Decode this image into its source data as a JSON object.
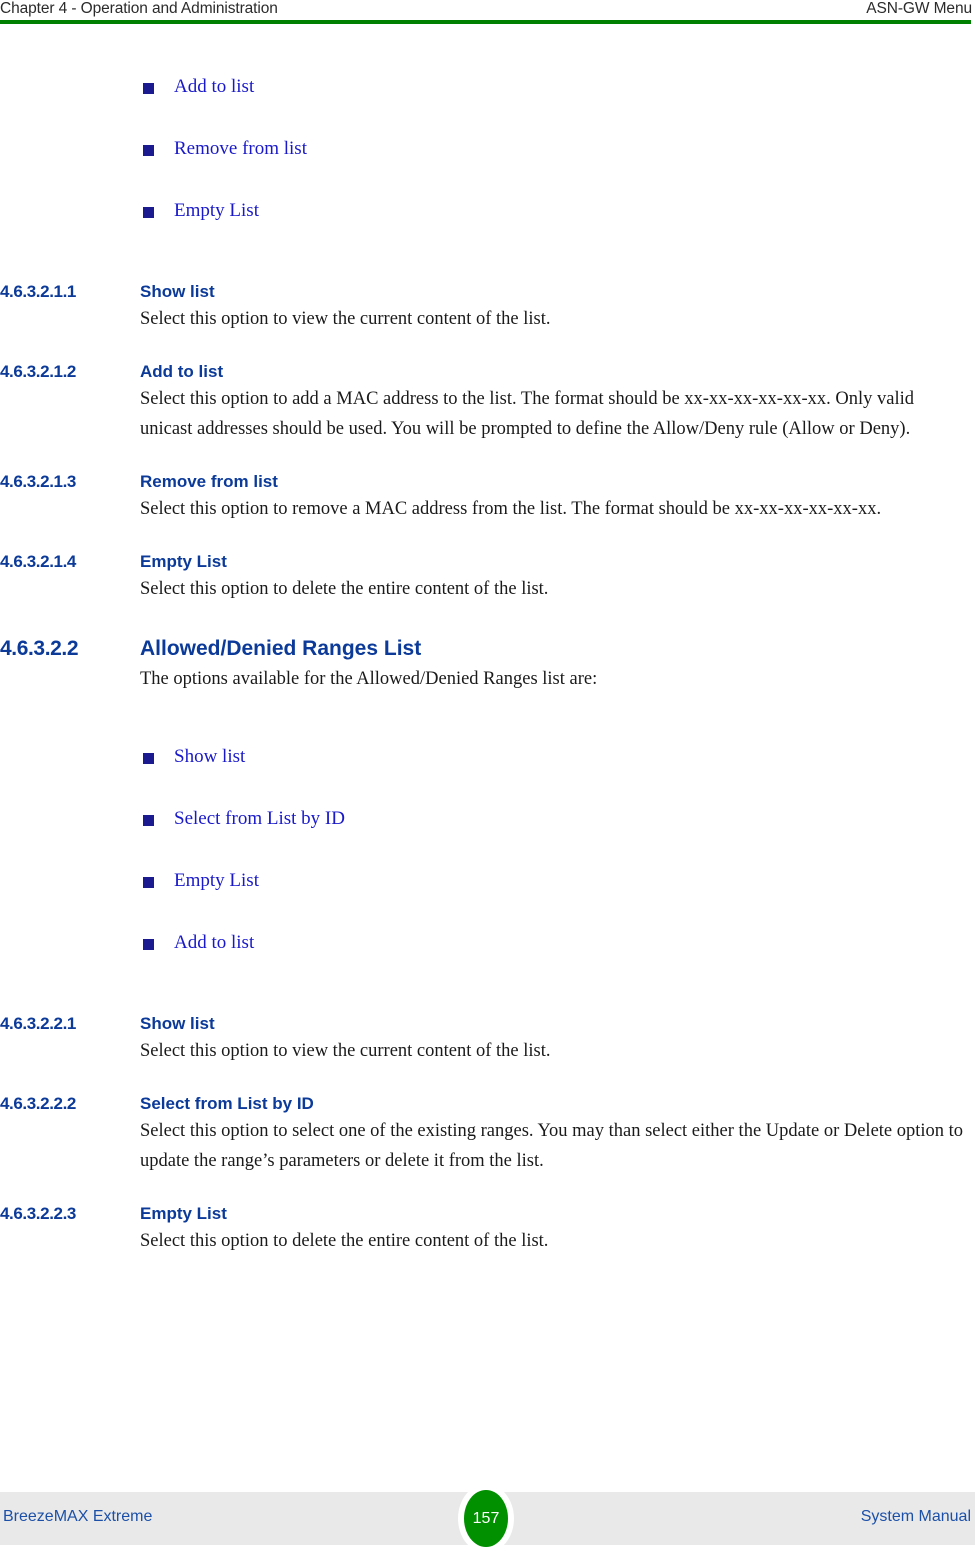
{
  "header": {
    "left": "Chapter 4 - Operation and Administration",
    "right": "ASN-GW Menu",
    "rule_color": "#008000"
  },
  "colors": {
    "heading": "#0b3a99",
    "bullet_text": "#1919c9",
    "bullet_square": "#1b1b8f",
    "body": "#1a1a1a",
    "footer_text": "#1c50a8",
    "footer_band": "#e9e9e9",
    "badge": "#009000",
    "green_rule": "#008000"
  },
  "top_list": {
    "items": [
      {
        "label": "Add to list"
      },
      {
        "label": "Remove from list"
      },
      {
        "label": "Empty List"
      }
    ]
  },
  "sections": [
    {
      "number": "4.6.3.2.1.1",
      "title": "Show list",
      "level": 5,
      "body": "Select this option to view the current content of the list."
    },
    {
      "number": "4.6.3.2.1.2",
      "title": "Add to list",
      "level": 5,
      "body": "Select this option to add a MAC address to the list. The format should be xx-xx-xx-xx-xx-xx. Only valid unicast addresses should be used. You will be prompted to define the Allow/Deny rule (Allow or Deny)."
    },
    {
      "number": "4.6.3.2.1.3",
      "title": "Remove from list",
      "level": 5,
      "body": "Select this option to remove a MAC address from the list. The format should be xx-xx-xx-xx-xx-xx."
    },
    {
      "number": "4.6.3.2.1.4",
      "title": "Empty List",
      "level": 5,
      "body": "Select this option to delete the entire content of the list."
    },
    {
      "number": "4.6.3.2.2",
      "title": "Allowed/Denied Ranges List",
      "level": 4,
      "body": "The options available for the Allowed/Denied Ranges list are:"
    }
  ],
  "second_list": {
    "items": [
      {
        "label": "Show list"
      },
      {
        "label": "Select from List by ID"
      },
      {
        "label": "Empty List"
      },
      {
        "label": "Add to list"
      }
    ]
  },
  "sections2": [
    {
      "number": "4.6.3.2.2.1",
      "title": "Show list",
      "level": 5,
      "body": "Select this option to view the current content of the list."
    },
    {
      "number": "4.6.3.2.2.2",
      "title": "Select from List by ID",
      "level": 5,
      "body": "Select this option to select one of the existing ranges. You may than select either the Update or Delete option to update the range’s parameters or delete it from the list."
    },
    {
      "number": "4.6.3.2.2.3",
      "title": "Empty List",
      "level": 5,
      "body": "Select this option to delete the entire content of the list."
    }
  ],
  "footer": {
    "left": "BreezeMAX Extreme",
    "page_number": "157",
    "right": "System Manual"
  }
}
